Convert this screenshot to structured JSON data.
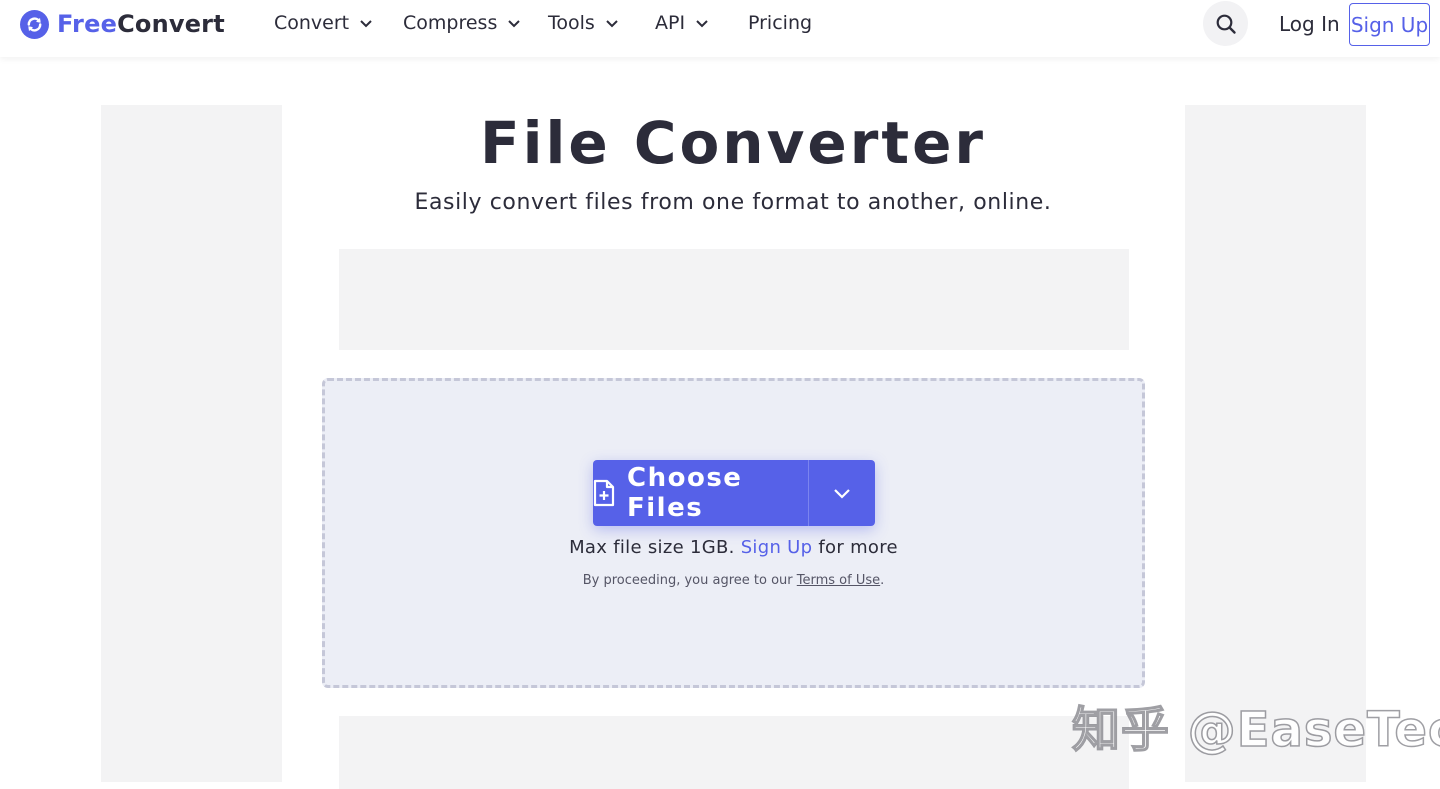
{
  "brand": {
    "part1": "Free",
    "part2": "Convert"
  },
  "nav": {
    "convert": "Convert",
    "compress": "Compress",
    "tools": "Tools",
    "api": "API",
    "pricing": "Pricing"
  },
  "header": {
    "login": "Log In",
    "signup": "Sign Up"
  },
  "hero": {
    "title": "File Converter",
    "subtitle": "Easily convert files from one format to another, online."
  },
  "upload": {
    "choose_label": "Choose Files",
    "max_prefix": "Max file size 1GB.",
    "max_link": "Sign Up",
    "max_suffix": "for more",
    "terms_prefix": "By proceeding, you agree to our",
    "terms_link": "Terms of Use",
    "terms_suffix": "."
  },
  "icons": {
    "logo": "refresh-circle-icon",
    "search": "search-icon",
    "chevron": "chevron-down-icon",
    "file": "file-plus-icon"
  },
  "colors": {
    "accent": "#5661e8",
    "text": "#2c2c3a",
    "dropzone_bg": "#eceef6",
    "ad_bg": "#f3f3f4"
  },
  "watermark": "知乎 @EaseTech"
}
